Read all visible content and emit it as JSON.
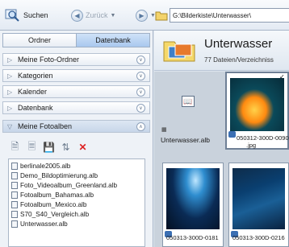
{
  "toolbar": {
    "search_label": "Suchen",
    "back_label": "Zurück",
    "path_value": "G:\\Bilderkiste\\Unterwasser\\"
  },
  "left_panel": {
    "tabs": [
      "Ordner",
      "Datenbank"
    ],
    "sections": [
      {
        "label": "Meine Foto-Ordner"
      },
      {
        "label": "Kategorien"
      },
      {
        "label": "Kalender"
      },
      {
        "label": "Datenbank"
      },
      {
        "label": "Meine Fotoalben"
      }
    ],
    "albums": [
      "berlinale2005.alb",
      "Demo_Bildoptimierung.alb",
      "Foto_Videoalbum_Greenland.alb",
      "Fotoalbum_Bahamas.alb",
      "Fotoalbum_Mexico.alb",
      "S70_S40_Vergleich.alb",
      "Unterwasser.alb"
    ]
  },
  "right_panel": {
    "title": "Unterwasser",
    "subtitle": "77 Dateien/Verzeichniss",
    "items": {
      "album_name": "Unterwasser.alb",
      "thumb1_caption_line1": "050312-300D-0090",
      "thumb1_caption_line2": ".jpg",
      "thumb2_caption": "050313-300D-0181",
      "thumb3_caption": "050313-300D-0216"
    }
  },
  "colors": {
    "accent_tab": "#a9c8ee",
    "panel_bg": "#eef2f7",
    "delete_icon": "#dd2222"
  }
}
